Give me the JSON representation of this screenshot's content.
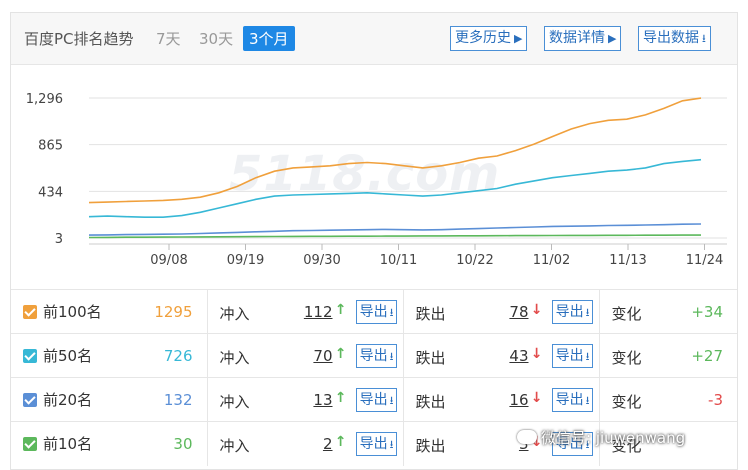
{
  "header": {
    "title": "百度PC排名趋势",
    "ranges": [
      "7天",
      "30天",
      "3个月"
    ],
    "active_range": "3个月",
    "buttons": {
      "history": "更多历史",
      "detail": "数据详情",
      "export": "导出数据"
    }
  },
  "chart_data": {
    "type": "line",
    "y_ticks": [
      "1,296",
      "865",
      "434",
      "3"
    ],
    "x_ticks": [
      "09/08",
      "09/19",
      "09/30",
      "10/11",
      "10/22",
      "11/02",
      "11/13",
      "11/24"
    ],
    "ylim": [
      3,
      1296
    ],
    "watermark": "5118.com",
    "series": [
      {
        "name": "前100名",
        "color": "#f0a03c",
        "values": [
          330,
          335,
          340,
          345,
          350,
          360,
          380,
          420,
          480,
          560,
          620,
          650,
          660,
          670,
          690,
          700,
          690,
          670,
          650,
          670,
          700,
          740,
          760,
          810,
          870,
          940,
          1010,
          1060,
          1090,
          1100,
          1140,
          1200,
          1270,
          1295
        ]
      },
      {
        "name": "前50名",
        "color": "#37b8d6",
        "values": [
          200,
          205,
          200,
          195,
          195,
          210,
          240,
          280,
          320,
          360,
          390,
          400,
          405,
          410,
          415,
          420,
          410,
          400,
          390,
          400,
          420,
          440,
          460,
          500,
          530,
          560,
          580,
          600,
          620,
          630,
          650,
          690,
          710,
          726
        ]
      },
      {
        "name": "前20名",
        "color": "#5b8fd6",
        "values": [
          30,
          32,
          34,
          36,
          38,
          40,
          45,
          50,
          55,
          60,
          65,
          70,
          72,
          75,
          78,
          80,
          82,
          80,
          78,
          80,
          85,
          90,
          95,
          100,
          105,
          110,
          112,
          115,
          118,
          120,
          123,
          126,
          130,
          132
        ]
      },
      {
        "name": "前10名",
        "color": "#5cb85c",
        "values": [
          8,
          9,
          10,
          10,
          11,
          12,
          13,
          14,
          15,
          16,
          17,
          18,
          19,
          19,
          20,
          20,
          21,
          21,
          22,
          22,
          23,
          23,
          24,
          25,
          25,
          26,
          27,
          27,
          28,
          28,
          29,
          29,
          30,
          30
        ]
      }
    ]
  },
  "table": {
    "in_label": "冲入",
    "out_label": "跌出",
    "change_label": "变化",
    "export_label": "导出",
    "rows": [
      {
        "name": "前100名",
        "color": "#f0a03c",
        "total": "1295",
        "in": "112",
        "out": "78",
        "change": "+34",
        "change_color": "#5cb85c",
        "total_color": "#f0a03c"
      },
      {
        "name": "前50名",
        "color": "#37b8d6",
        "total": "726",
        "in": "70",
        "out": "43",
        "change": "+27",
        "change_color": "#5cb85c",
        "total_color": "#37b8d6"
      },
      {
        "name": "前20名",
        "color": "#5b8fd6",
        "total": "132",
        "in": "13",
        "out": "16",
        "change": "-3",
        "change_color": "#e24b4b",
        "total_color": "#5b8fd6"
      },
      {
        "name": "前10名",
        "color": "#5cb85c",
        "total": "30",
        "in": "2",
        "out": "3",
        "change": "",
        "change_color": "#e24b4b",
        "total_color": "#5cb85c"
      }
    ]
  },
  "overlay": {
    "text": "微信号: jiuwenwang"
  }
}
